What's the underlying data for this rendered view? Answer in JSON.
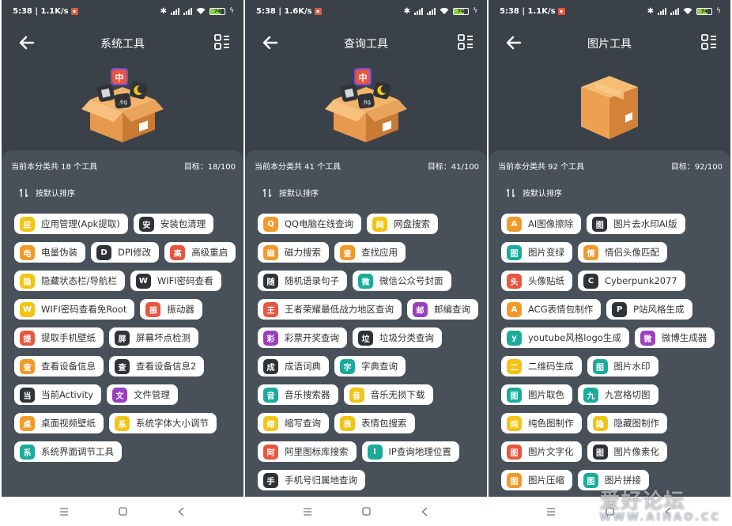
{
  "statusbar": {
    "screens": [
      {
        "time": "5:38 | 1.1K/s",
        "battery": "74"
      },
      {
        "time": "5:38 | 1.6K/s",
        "battery": "74"
      },
      {
        "time": "5:38 | 1.1K/s",
        "battery": "74"
      }
    ]
  },
  "screens": [
    {
      "title": "系统工具",
      "summary_left": "当前本分类共 18 个工具",
      "summary_right": "目标：18/100",
      "sort_label": "按默认排序",
      "hero": "box-with-icons",
      "chips": [
        {
          "icon": "应",
          "label": "应用管理(Apk提取)",
          "color": "#f2c417"
        },
        {
          "icon": "安",
          "label": "安装包清理",
          "color": "#2f3337"
        },
        {
          "icon": "电",
          "label": "电量伪装",
          "color": "#f19a2a"
        },
        {
          "icon": "D",
          "label": "DPI修改",
          "color": "#2f3337"
        },
        {
          "icon": "高",
          "label": "高级重启",
          "color": "#e8563f"
        },
        {
          "icon": "隐",
          "label": "隐藏状态栏/导航栏",
          "color": "#f2c417"
        },
        {
          "icon": "W",
          "label": "WIFI密码查看",
          "color": "#2f3337"
        },
        {
          "icon": "W",
          "label": "WIFI密码查看免Root",
          "color": "#f2c417"
        },
        {
          "icon": "振",
          "label": "振动器",
          "color": "#e8563f"
        },
        {
          "icon": "提",
          "label": "提取手机壁纸",
          "color": "#e8563f"
        },
        {
          "icon": "屏",
          "label": "屏幕坏点检测",
          "color": "#2f3337"
        },
        {
          "icon": "查",
          "label": "查看设备信息",
          "color": "#f19a2a"
        },
        {
          "icon": "查",
          "label": "查看设备信息2",
          "color": "#2f3337"
        },
        {
          "icon": "当",
          "label": "当前Activity",
          "color": "#2f3337"
        },
        {
          "icon": "文",
          "label": "文件管理",
          "color": "#9a3fc0"
        },
        {
          "icon": "桌",
          "label": "桌面视频壁纸",
          "color": "#f19a2a"
        },
        {
          "icon": "系",
          "label": "系统字体大小调节",
          "color": "#f2c417"
        },
        {
          "icon": "系",
          "label": "系统界面调节工具",
          "color": "#1aab9b"
        }
      ]
    },
    {
      "title": "查询工具",
      "summary_left": "当前本分类共 41 个工具",
      "summary_right": "目标：41/100",
      "sort_label": "按默认排序",
      "hero": "box-with-icons",
      "chips": [
        {
          "icon": "Q",
          "label": "QQ电脑在线查询",
          "color": "#f19a2a"
        },
        {
          "icon": "网",
          "label": "网盘搜索",
          "color": "#f2c417"
        },
        {
          "icon": "磁",
          "label": "磁力搜索",
          "color": "#f19a2a"
        },
        {
          "icon": "查",
          "label": "查找应用",
          "color": "#f19a2a"
        },
        {
          "icon": "随",
          "label": "随机语录句子",
          "color": "#2f3337"
        },
        {
          "icon": "微",
          "label": "微信公众号封面",
          "color": "#1aab9b"
        },
        {
          "icon": "王",
          "label": "王者荣耀最低战力地区查询",
          "color": "#e8563f"
        },
        {
          "icon": "邮",
          "label": "邮编查询",
          "color": "#9a3fc0"
        },
        {
          "icon": "彩",
          "label": "彩票开奖查询",
          "color": "#9a3fc0"
        },
        {
          "icon": "垃",
          "label": "垃圾分类查询",
          "color": "#2f3337"
        },
        {
          "icon": "成",
          "label": "成语词典",
          "color": "#2f3337"
        },
        {
          "icon": "字",
          "label": "字典查询",
          "color": "#1aab9b"
        },
        {
          "icon": "音",
          "label": "音乐搜索器",
          "color": "#1aab9b"
        },
        {
          "icon": "音",
          "label": "音乐无损下载",
          "color": "#f2c417"
        },
        {
          "icon": "缩",
          "label": "缩写查询",
          "color": "#f2c417"
        },
        {
          "icon": "表",
          "label": "表情包搜索",
          "color": "#f2c417"
        },
        {
          "icon": "阿",
          "label": "阿里图标库搜索",
          "color": "#e8563f"
        },
        {
          "icon": "I",
          "label": "IP查询地理位置",
          "color": "#1aab9b"
        },
        {
          "icon": "手",
          "label": "手机号归属地查询",
          "color": "#2f3337"
        }
      ]
    },
    {
      "title": "图片工具",
      "summary_left": "当前本分类共 92 个工具",
      "summary_right": "目标：92/100",
      "sort_label": "按默认排序",
      "hero": "plain-box",
      "chips": [
        {
          "icon": "A",
          "label": "AI图像擦除",
          "color": "#f19a2a"
        },
        {
          "icon": "图",
          "label": "图片去水印AI版",
          "color": "#2f3337"
        },
        {
          "icon": "图",
          "label": "图片变绿",
          "color": "#1aab9b"
        },
        {
          "icon": "情",
          "label": "情侣头像匹配",
          "color": "#f19a2a"
        },
        {
          "icon": "头",
          "label": "头像贴纸",
          "color": "#e8563f"
        },
        {
          "icon": "C",
          "label": "Cyberpunk2077",
          "color": "#2f3337"
        },
        {
          "icon": "A",
          "label": "ACG表情包制作",
          "color": "#f19a2a"
        },
        {
          "icon": "P",
          "label": "P站风格生成",
          "color": "#2f3337"
        },
        {
          "icon": "y",
          "label": "youtube风格logo生成",
          "color": "#1aab9b"
        },
        {
          "icon": "微",
          "label": "微博生成器",
          "color": "#9a3fc0"
        },
        {
          "icon": "二",
          "label": "二维码生成",
          "color": "#f2c417"
        },
        {
          "icon": "图",
          "label": "图片水印",
          "color": "#1aab9b"
        },
        {
          "icon": "图",
          "label": "图片取色",
          "color": "#1aab9b"
        },
        {
          "icon": "九",
          "label": "九宫格切图",
          "color": "#1aab9b"
        },
        {
          "icon": "纯",
          "label": "纯色图制作",
          "color": "#f2c417"
        },
        {
          "icon": "隐",
          "label": "隐藏图制作",
          "color": "#f2c417"
        },
        {
          "icon": "图",
          "label": "图片文字化",
          "color": "#e8563f"
        },
        {
          "icon": "图",
          "label": "图片像素化",
          "color": "#2f3337"
        },
        {
          "icon": "图",
          "label": "图片压缩",
          "color": "#f19a2a"
        },
        {
          "icon": "图",
          "label": "图片拼接",
          "color": "#1aab9b"
        }
      ]
    }
  ],
  "watermark": {
    "text": "爱好论坛",
    "sub": "WWW.AIHAO.CC"
  },
  "colors": {
    "background": "#3b4148",
    "sheet": "#48505a",
    "chip": "#ffffff"
  }
}
